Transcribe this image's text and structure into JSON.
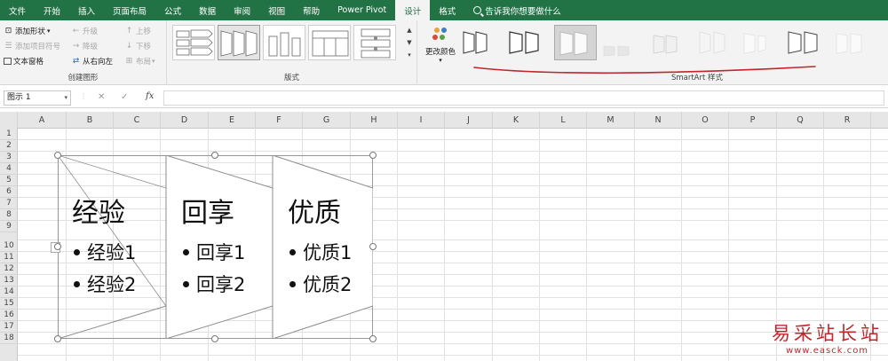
{
  "ribbon_tabs": [
    "文件",
    "开始",
    "插入",
    "页面布局",
    "公式",
    "数据",
    "审阅",
    "视图",
    "帮助",
    "Power Pivot",
    "设计",
    "格式"
  ],
  "active_tab": "设计",
  "tell_me": "告诉我你想要做什么",
  "create_graphic": {
    "add_shape": "添加形状",
    "add_bullet": "添加项目符号",
    "text_pane": "文本窗格",
    "promote": "升级",
    "demote": "降级",
    "right_to_left": "从右向左",
    "move_up": "上移",
    "move_down": "下移",
    "layout": "布局",
    "label": "创建图形"
  },
  "layouts": {
    "label": "版式"
  },
  "change_colors": "更改颜色",
  "styles": {
    "label": "SmartArt 样式"
  },
  "name_box": "图示 1",
  "formula_icons": {
    "cancel": "✕",
    "enter": "✓",
    "fx": "fx"
  },
  "columns": [
    "A",
    "B",
    "C",
    "D",
    "E",
    "F",
    "G",
    "H",
    "I",
    "J",
    "K",
    "L",
    "M",
    "N",
    "O",
    "P",
    "Q",
    "R"
  ],
  "rows": [
    "1",
    "2",
    "3",
    "4",
    "5",
    "6",
    "7",
    "8",
    "9",
    "10",
    "11",
    "12",
    "13",
    "14",
    "15",
    "16",
    "17",
    "18"
  ],
  "smartart": {
    "panels": [
      {
        "title": "经验",
        "bullets": [
          "经验1",
          "经验2"
        ]
      },
      {
        "title": "回享",
        "bullets": [
          "回享1",
          "回享2"
        ]
      },
      {
        "title": "优质",
        "bullets": [
          "优质1",
          "优质2"
        ]
      }
    ]
  },
  "watermark": {
    "title": "易采站长站",
    "url": "www.easck.com"
  },
  "colors": {
    "excel_green": "#217346",
    "underline_red": "#c0262c"
  }
}
